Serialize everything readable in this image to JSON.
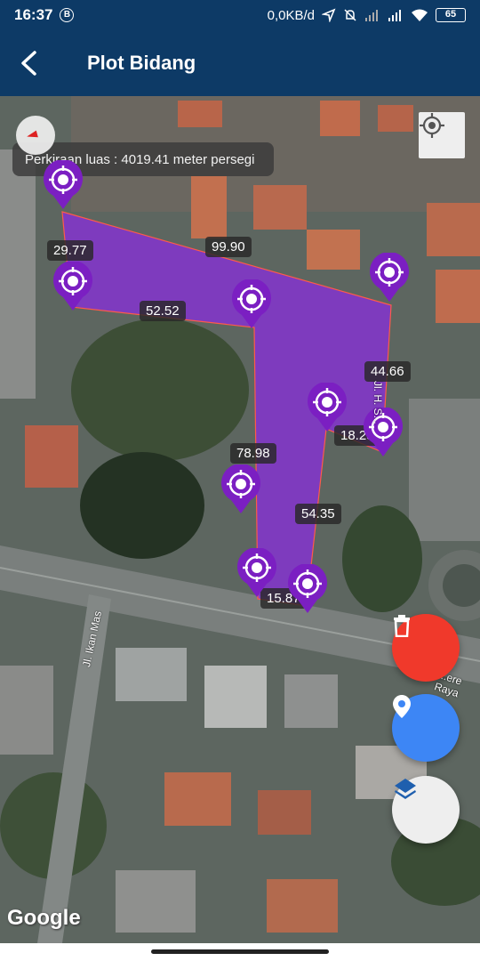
{
  "status_bar": {
    "time": "16:37",
    "b_badge": "B",
    "network_speed": "0,0KB/d",
    "battery": "65",
    "icons": [
      "b-icon",
      "location-arrow-icon",
      "alarm-off-icon",
      "signal-icon",
      "signal-icon",
      "wifi-icon",
      "battery-icon"
    ]
  },
  "app_bar": {
    "title": "Plot Bidang",
    "back_icon": "back-arrow-icon"
  },
  "map": {
    "area_text": "Perkiraan luas : 4019.41 meter persegi",
    "distance_labels": [
      "29.77",
      "99.90",
      "52.52",
      "44.66",
      "18.28",
      "78.98",
      "54.35",
      "15.87"
    ],
    "road_labels": [
      "Jl. Ikan Mas",
      "Jl. H. S...",
      "...ere Raya"
    ],
    "attribution": "Google",
    "polygon_color": "#8a2be2",
    "marker_color": "#7b1fc2",
    "marker_icon": "crosshair-marker-icon",
    "marker_count": 11
  },
  "controls": {
    "compass": "compass-icon",
    "my_location": "crosshair-icon",
    "delete": "trash-icon",
    "add_pin": "pin-icon",
    "layers": "layers-icon",
    "delete_color": "#f0392b",
    "pin_color": "#3d86f5"
  }
}
